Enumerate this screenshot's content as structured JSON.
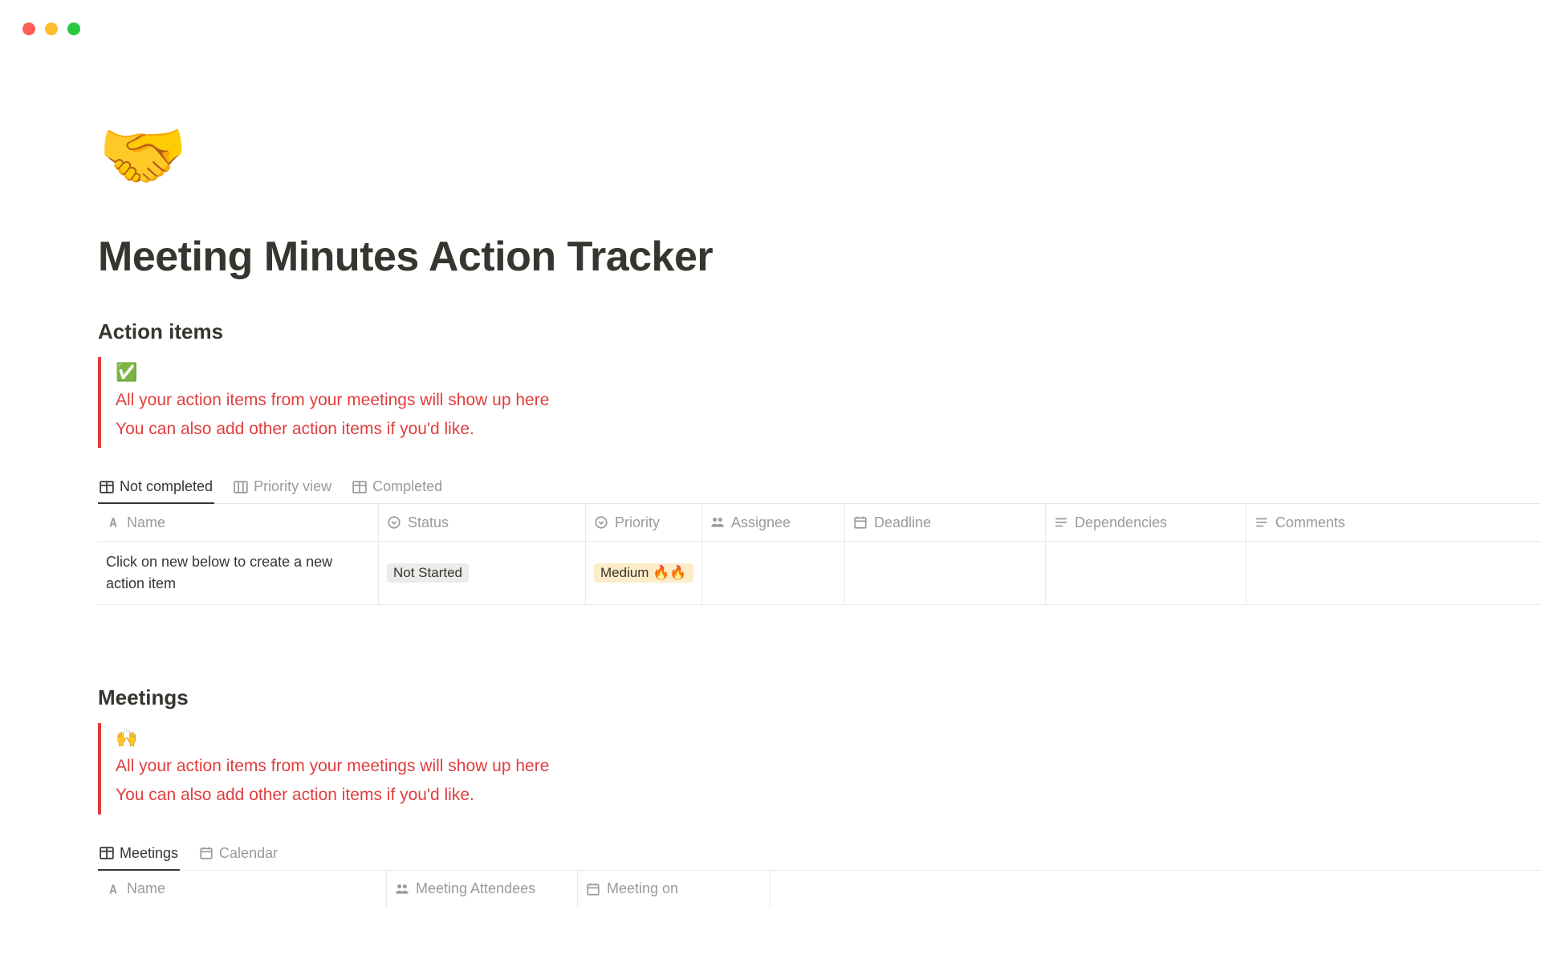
{
  "page": {
    "icon": "🤝",
    "title": "Meeting Minutes Action Tracker"
  },
  "actionItems": {
    "heading": "Action items",
    "callout": {
      "icon": "✅",
      "line1": "All your action items from your meetings will show up here",
      "line2": "You can also add other action items if you'd like."
    },
    "tabs": [
      {
        "label": "Not completed"
      },
      {
        "label": "Priority view"
      },
      {
        "label": "Completed"
      }
    ],
    "columns": {
      "name": "Name",
      "status": "Status",
      "priority": "Priority",
      "assignee": "Assignee",
      "deadline": "Deadline",
      "dependencies": "Dependencies",
      "comments": "Comments"
    },
    "rows": [
      {
        "name": "Click on new below to create a new action item",
        "status": "Not Started",
        "priority": "Medium 🔥🔥"
      }
    ]
  },
  "meetings": {
    "heading": "Meetings",
    "callout": {
      "icon": "🙌",
      "line1": "All your action items from your meetings will show up here",
      "line2": "You can also add other action items if you'd like."
    },
    "tabs": [
      {
        "label": "Meetings"
      },
      {
        "label": "Calendar"
      }
    ],
    "columns": {
      "name": "Name",
      "attendees": "Meeting Attendees",
      "meetingOn": "Meeting on"
    }
  }
}
